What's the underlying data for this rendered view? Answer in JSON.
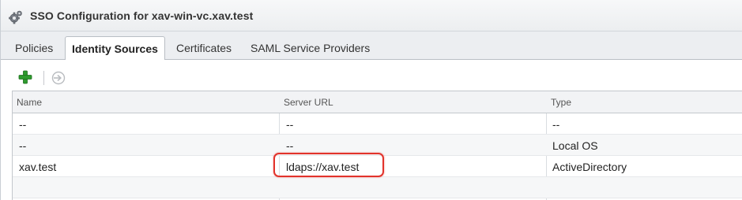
{
  "window": {
    "title": "SSO Configuration for xav-win-vc.xav.test",
    "icon": "gear-cog-icon"
  },
  "tabs": [
    {
      "label": "Policies",
      "active": false
    },
    {
      "label": "Identity Sources",
      "active": true
    },
    {
      "label": "Certificates",
      "active": false
    },
    {
      "label": "SAML Service Providers",
      "active": false
    }
  ],
  "toolbar": {
    "add_icon": "plus-icon",
    "set_default_icon": "set-default-icon",
    "add_color": "#2e9b2e"
  },
  "table": {
    "columns": [
      "Name",
      "Server URL",
      "Type"
    ],
    "rows": [
      {
        "name": "--",
        "server_url": "--",
        "type": "--"
      },
      {
        "name": "--",
        "server_url": "--",
        "type": "Local OS"
      },
      {
        "name": "xav.test",
        "server_url": "ldaps://xav.test",
        "type": "ActiveDirectory"
      }
    ]
  },
  "annotation": {
    "highlight_color": "#e2332b"
  }
}
